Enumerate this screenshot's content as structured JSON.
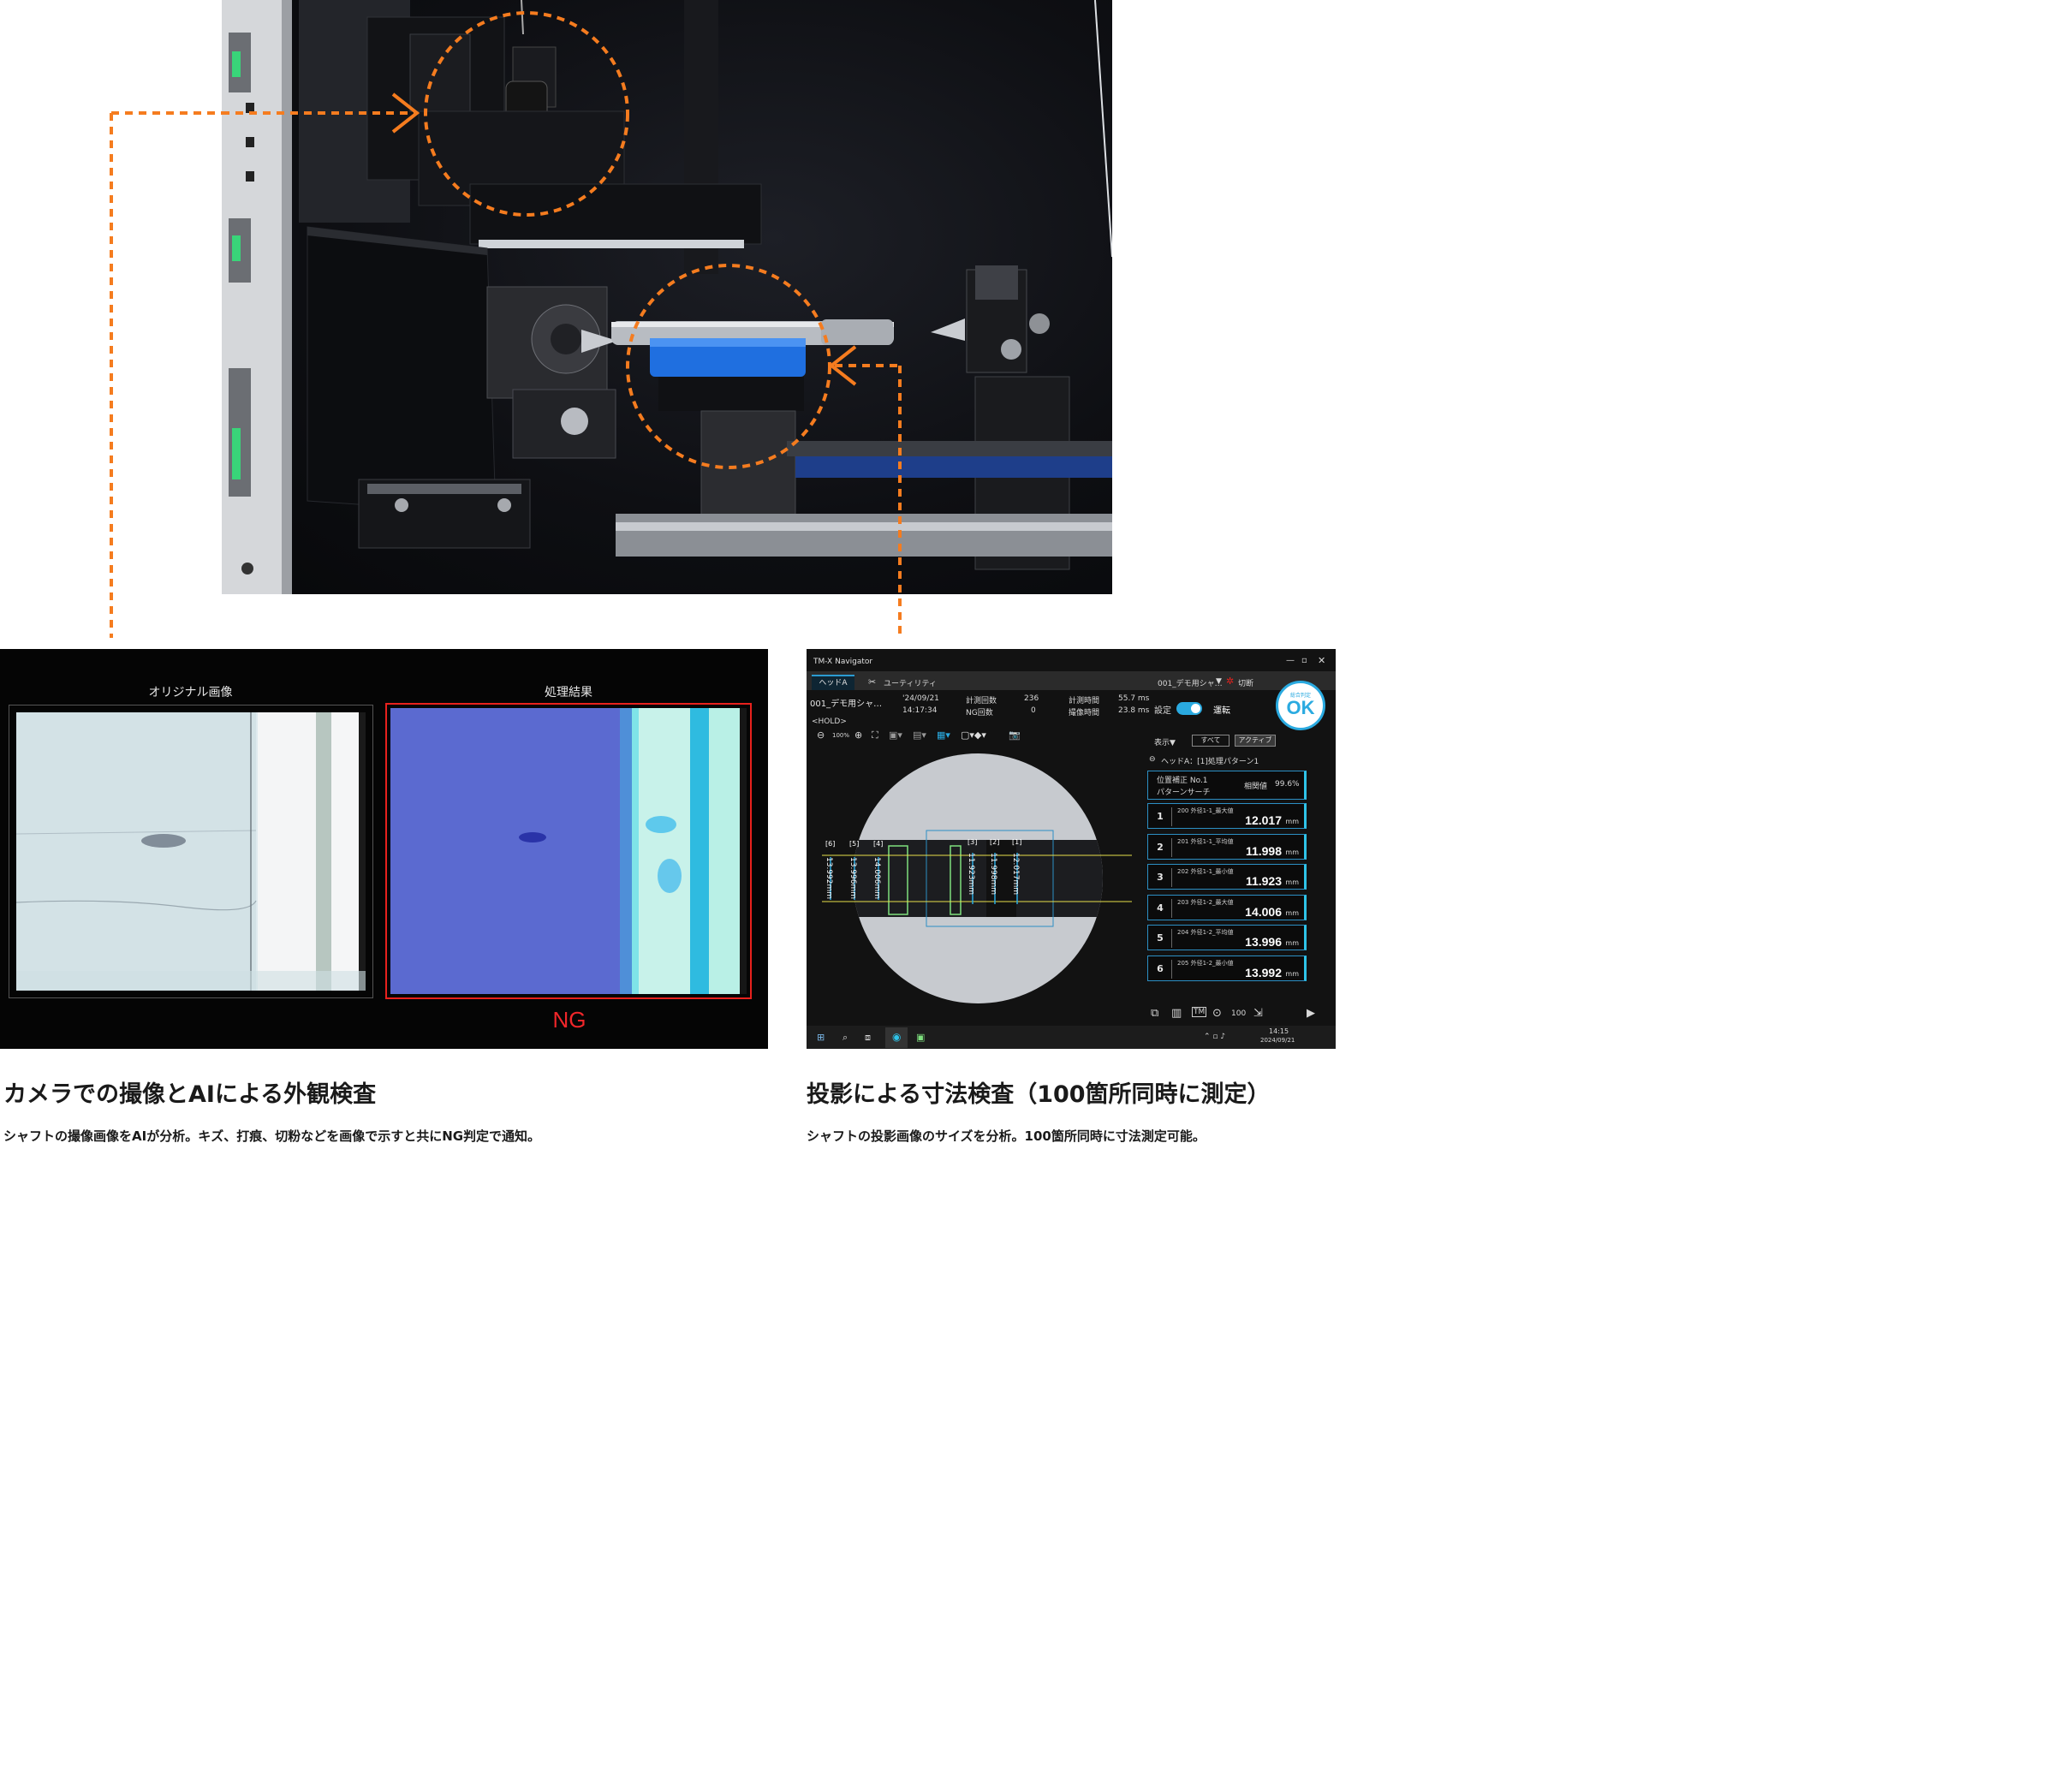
{
  "colors": {
    "callout": "#f57c1f",
    "ng_red": "#e8211d",
    "ok_blue": "#2aaae0",
    "measure_border": "#2c8fc4"
  },
  "ai_screen": {
    "original_title": "オリジナル画像",
    "result_title": "処理結果",
    "verdict": "NG"
  },
  "navigator": {
    "window_title": "TM-X Navigator",
    "tabs": [
      {
        "label": "ヘッドA",
        "active": true
      },
      {
        "label": "ユーティリティ",
        "active": false
      }
    ],
    "program_name": "001_デモ用シャ…",
    "program_select": "001_デモ用シャ…",
    "switch_label": "切断",
    "date": "'24/09/21",
    "time": "14:17:34",
    "count_label": "計測回数",
    "count_value": "236",
    "ng_count_label": "NG回数",
    "ng_count_value": "0",
    "measure_time_label": "計測時間",
    "measure_time_value": "55.7 ms",
    "capture_time_label": "撮像時間",
    "capture_time_value": "23.8 ms",
    "setting_label": "設定",
    "run_label": "運転",
    "hold_label": "<HOLD>",
    "zoom_label": "100%",
    "overall_label": "総合判定",
    "overall_result": "OK",
    "display_label": "表示▼",
    "filter_all": "すべて",
    "filter_active": "アクティブ",
    "head_pattern": "ヘッドA：[1]処理パターン1",
    "position_card": {
      "title": "位置補正 No.1",
      "sub": "パターンサーチ",
      "corr_label": "相関値",
      "corr_value": "99.6%"
    },
    "measurements": [
      {
        "idx": "1",
        "name": "200 外径1-1_最大値",
        "value": "12.017",
        "unit": "mm"
      },
      {
        "idx": "2",
        "name": "201 外径1-1_平均値",
        "value": "11.998",
        "unit": "mm"
      },
      {
        "idx": "3",
        "name": "202 外径1-1_最小値",
        "value": "11.923",
        "unit": "mm"
      },
      {
        "idx": "4",
        "name": "203 外径1-2_最大値",
        "value": "14.006",
        "unit": "mm"
      },
      {
        "idx": "5",
        "name": "204 外径1-2_平均値",
        "value": "13.996",
        "unit": "mm"
      },
      {
        "idx": "6",
        "name": "205 外径1-2_最小値",
        "value": "13.992",
        "unit": "mm"
      }
    ],
    "dim_labels": [
      {
        "tag": "[6]",
        "value": "13.992mm"
      },
      {
        "tag": "[5]",
        "value": "13.996mm"
      },
      {
        "tag": "[4]",
        "value": "14.006mm"
      },
      {
        "tag": "[3]",
        "value": "11.923mm"
      },
      {
        "tag": "[2]",
        "value": "11.998mm"
      },
      {
        "tag": "[1]",
        "value": "12.017mm"
      }
    ],
    "taskbar_time": "14:15",
    "taskbar_date": "2024/09/21",
    "bottom_counter": "100"
  },
  "captions": {
    "left_title": "カメラでの撮像とAIによる外観検査",
    "left_desc": "シャフトの撮像画像をAIが分析。キズ、打痕、切粉などを画像で示すと共にNG判定で通知。",
    "right_title": "投影による寸法検査（100箇所同時に測定）",
    "right_desc": "シャフトの投影画像のサイズを分析。100箇所同時に寸法測定可能。"
  }
}
